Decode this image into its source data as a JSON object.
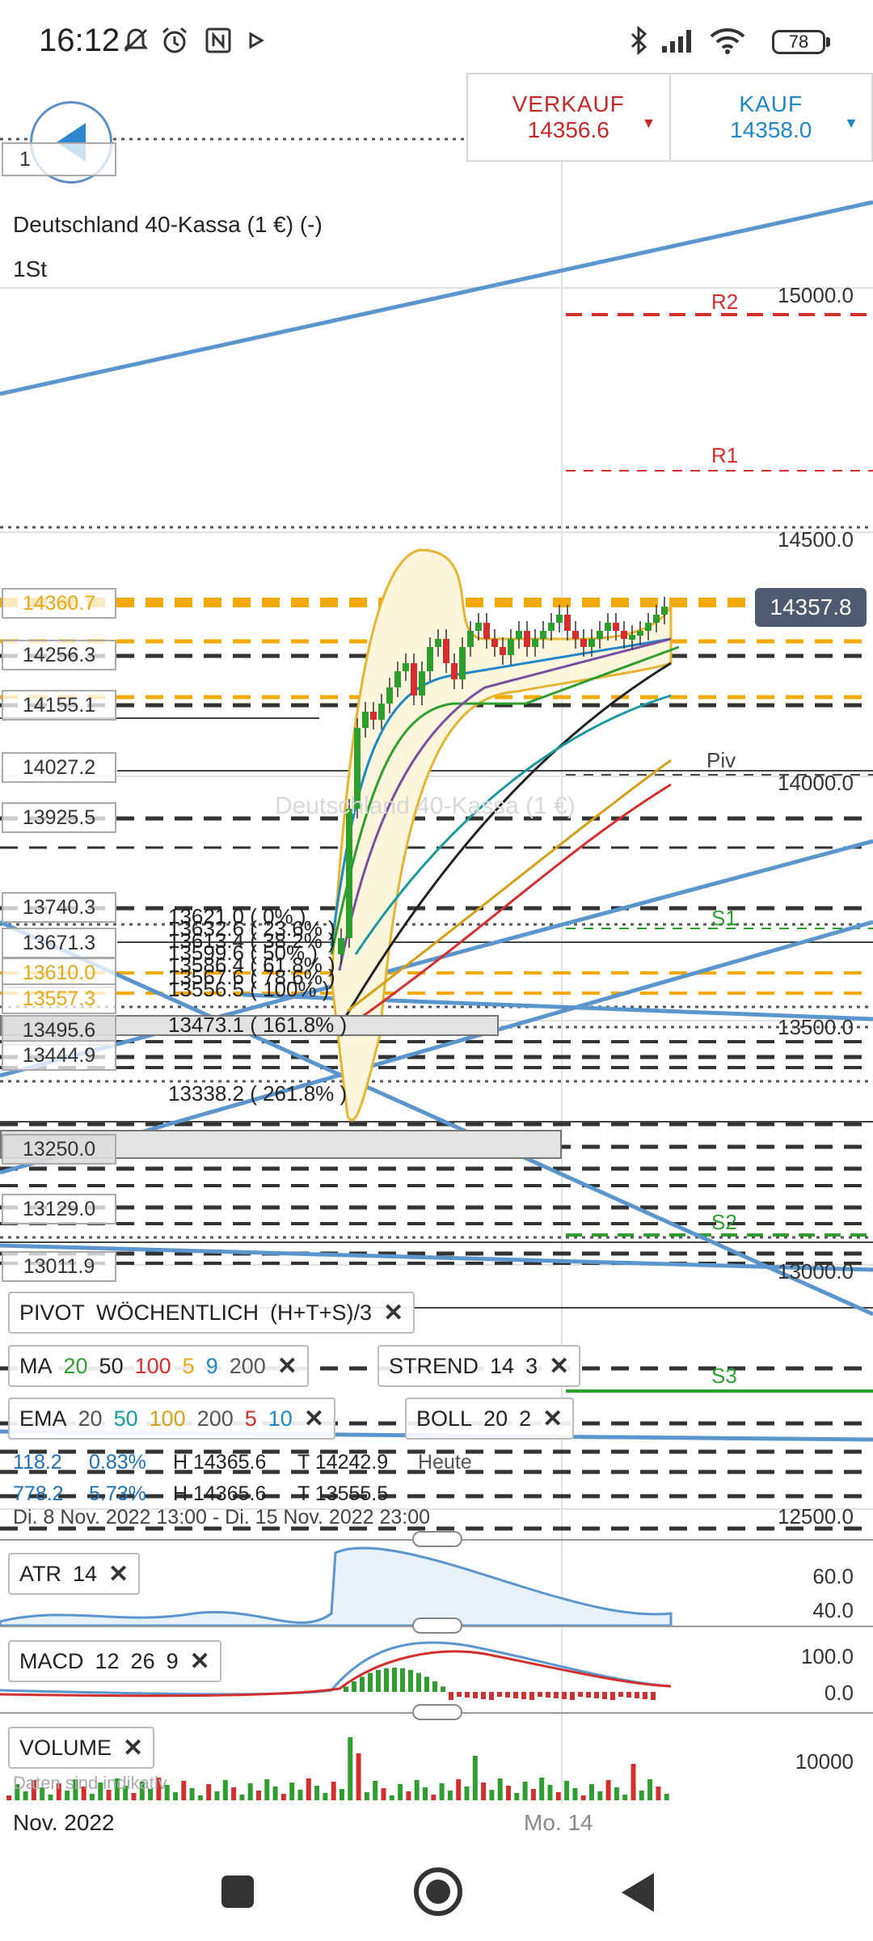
{
  "status_bar": {
    "time": "16:12",
    "battery": "78",
    "icons": [
      "mute-bell-icon",
      "alarm-icon",
      "nfc-icon",
      "play-icon",
      "bluetooth-icon",
      "signal-icon",
      "wifi-icon",
      "battery-icon"
    ]
  },
  "quote": {
    "sell_label": "VERKAUF",
    "sell_value": "14356.6",
    "buy_label": "KAUF",
    "buy_value": "14358.0",
    "sell_color": "#c62828",
    "buy_color": "#1e88c7"
  },
  "instrument": {
    "title": "Deutschland 40-Kassa (1 €) (-)",
    "timeframe": "1St",
    "watermark": "Deutschland 40-Kassa (1 €)"
  },
  "price_axis": [
    "15000.0",
    "14500.0",
    "14000.0",
    "13500.0",
    "13000.0",
    "12500.0"
  ],
  "current_price": "14357.8",
  "pivots": {
    "r2": "R2",
    "r1": "R1",
    "piv": "Piv",
    "s1": "S1",
    "s2": "S2",
    "s3": "S3"
  },
  "left_levels": [
    "1",
    "14360.7",
    "14256.3",
    "14155.1",
    "14027.2",
    "13925.5",
    "13740.3",
    "13671.3",
    "13610.0",
    "13557.3",
    "13495.6",
    "13444.9",
    "13250.0",
    "13129.0",
    "13011.9"
  ],
  "fib_labels": [
    "13621.0 ( 0% )",
    "13632.6 ( 23.6% )",
    "13613.4 ( 38.2% )",
    "13599.6 ( 50% )",
    "13586.4 ( 61.8% )",
    "13567.6 ( 78.6% )",
    "13556.5 ( 100% )",
    "13473.1 ( 161.8% )",
    "13338.2 ( 261.8% )"
  ],
  "indicators": {
    "pivot": {
      "name": "PIVOT",
      "mode": "WÖCHENTLICH",
      "formula": "(H+T+S)/3"
    },
    "ma": {
      "name": "MA",
      "periods": [
        "20",
        "50",
        "100",
        "5",
        "9",
        "200"
      ],
      "colors": [
        "#2e9e2e",
        "#222222",
        "#d32f2f",
        "#e6a817",
        "#1e88c7",
        "#555555"
      ]
    },
    "strend": {
      "name": "STREND",
      "p1": "14",
      "p2": "3"
    },
    "ema": {
      "name": "EMA",
      "periods": [
        "20",
        "50",
        "100",
        "200",
        "5",
        "10"
      ],
      "colors": [
        "#555555",
        "#1a9aa0",
        "#d4a017",
        "#555555",
        "#d32f2f",
        "#1e88c7"
      ]
    },
    "boll": {
      "name": "BOLL",
      "p1": "20",
      "p2": "2"
    },
    "atr": {
      "name": "ATR",
      "p1": "14"
    },
    "macd": {
      "name": "MACD",
      "p1": "12",
      "p2": "26",
      "p3": "9"
    },
    "volume": {
      "name": "VOLUME"
    }
  },
  "stats": {
    "row1": {
      "chg": "118.2",
      "pct": "0.83%",
      "high": "H 14365.6",
      "low": "T 14242.9",
      "period": "Heute"
    },
    "row2": {
      "chg": "778.2",
      "pct": "5.73%",
      "high": "H 14365.6",
      "low": "T 13555.5"
    },
    "range": "Di. 8 Nov. 2022 13:00 - Di. 15 Nov. 2022 23:00"
  },
  "atr_axis": [
    "60.0",
    "40.0"
  ],
  "macd_axis": [
    "100.0",
    "0.0"
  ],
  "volume_axis": [
    "10000"
  ],
  "disclaimer": "Daten sind indikativ",
  "x_axis": {
    "left": "Nov. 2022",
    "mid": "Mo. 14"
  },
  "nav": [
    "recents-button",
    "home-button",
    "back-button"
  ]
}
